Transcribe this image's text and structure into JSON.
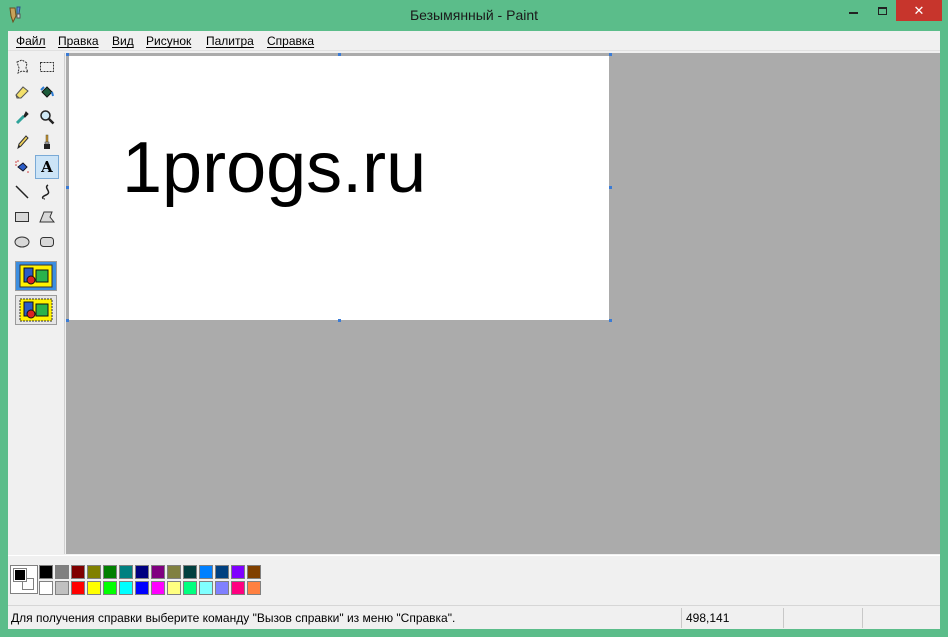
{
  "window": {
    "title": "Безымянный - Paint"
  },
  "menu": [
    "Файл",
    "Правка",
    "Вид",
    "Рисунок",
    "Палитра",
    "Справка"
  ],
  "tools": [
    {
      "name": "free-select-icon",
      "active": false
    },
    {
      "name": "rect-select-icon",
      "active": false
    },
    {
      "name": "eraser-icon",
      "active": false
    },
    {
      "name": "fill-bucket-icon",
      "active": false
    },
    {
      "name": "color-picker-icon",
      "active": false
    },
    {
      "name": "magnifier-icon",
      "active": false
    },
    {
      "name": "pencil-icon",
      "active": false
    },
    {
      "name": "brush-icon",
      "active": false
    },
    {
      "name": "airbrush-icon",
      "active": false
    },
    {
      "name": "text-tool-icon",
      "active": true
    },
    {
      "name": "line-icon",
      "active": false
    },
    {
      "name": "curve-icon",
      "active": false
    },
    {
      "name": "rectangle-icon",
      "active": false
    },
    {
      "name": "polygon-icon",
      "active": false
    },
    {
      "name": "ellipse-icon",
      "active": false
    },
    {
      "name": "rounded-rectangle-icon",
      "active": false
    }
  ],
  "text_tool_glyph": "A",
  "canvas": {
    "text": "1progs.ru"
  },
  "palette": {
    "foreground": "#000000",
    "background": "#ffffff",
    "row1": [
      "#000000",
      "#808080",
      "#800000",
      "#808000",
      "#008000",
      "#008080",
      "#000080",
      "#800080",
      "#808040",
      "#004040",
      "#0080ff",
      "#004080",
      "#8000ff",
      "#804000"
    ],
    "row2": [
      "#ffffff",
      "#c0c0c0",
      "#ff0000",
      "#ffff00",
      "#00ff00",
      "#00ffff",
      "#0000ff",
      "#ff00ff",
      "#ffff80",
      "#00ff80",
      "#80ffff",
      "#8080ff",
      "#ff0080",
      "#ff8040"
    ]
  },
  "status": {
    "help": "Для получения справки выберите команду \"Вызов справки\" из меню \"Справка\".",
    "coords": "498,141"
  },
  "colors": {
    "titlebar": "#5bbd8a",
    "close_button": "#c7352c",
    "workspace": "#ababab",
    "selection_handle": "#3a7bd5"
  }
}
